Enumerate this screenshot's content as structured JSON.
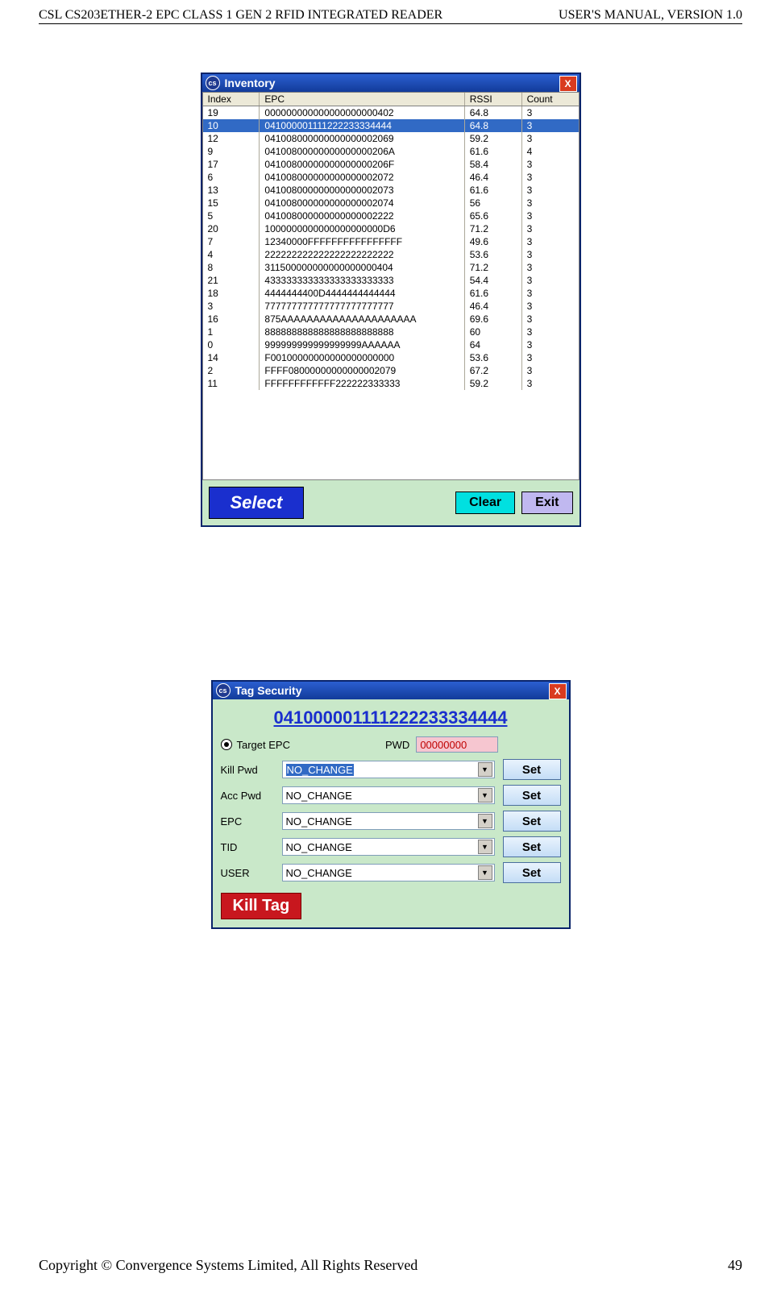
{
  "header": {
    "left": "CSL CS203ETHER-2 EPC CLASS 1 GEN 2 RFID INTEGRATED READER",
    "right": "USER'S  MANUAL,  VERSION  1.0"
  },
  "footer": {
    "left": "Copyright © Convergence Systems Limited, All Rights Reserved",
    "right": "49"
  },
  "inventory": {
    "title": "Inventory",
    "close": "X",
    "columns": {
      "index": "Index",
      "epc": "EPC",
      "rssi": "RSSI",
      "count": "Count"
    },
    "rows": [
      {
        "idx": "19",
        "epc": "000000000000000000000402",
        "rssi": "64.8",
        "cnt": "3",
        "sel": false
      },
      {
        "idx": "10",
        "epc": "041000001111222233334444",
        "rssi": "64.8",
        "cnt": "3",
        "sel": true
      },
      {
        "idx": "12",
        "epc": "041008000000000000002069",
        "rssi": "59.2",
        "cnt": "3",
        "sel": false
      },
      {
        "idx": "9",
        "epc": "04100800000000000000206A",
        "rssi": "61.6",
        "cnt": "4",
        "sel": false
      },
      {
        "idx": "17",
        "epc": "04100800000000000000206F",
        "rssi": "58.4",
        "cnt": "3",
        "sel": false
      },
      {
        "idx": "6",
        "epc": "041008000000000000002072",
        "rssi": "46.4",
        "cnt": "3",
        "sel": false
      },
      {
        "idx": "13",
        "epc": "041008000000000000002073",
        "rssi": "61.6",
        "cnt": "3",
        "sel": false
      },
      {
        "idx": "15",
        "epc": "041008000000000000002074",
        "rssi": "56",
        "cnt": "3",
        "sel": false
      },
      {
        "idx": "5",
        "epc": "041008000000000000002222",
        "rssi": "65.6",
        "cnt": "3",
        "sel": false
      },
      {
        "idx": "20",
        "epc": "1000000000000000000000D6",
        "rssi": "71.2",
        "cnt": "3",
        "sel": false
      },
      {
        "idx": "7",
        "epc": "12340000FFFFFFFFFFFFFFFF",
        "rssi": "49.6",
        "cnt": "3",
        "sel": false
      },
      {
        "idx": "4",
        "epc": "222222222222222222222222",
        "rssi": "53.6",
        "cnt": "3",
        "sel": false
      },
      {
        "idx": "8",
        "epc": "311500000000000000000404",
        "rssi": "71.2",
        "cnt": "3",
        "sel": false
      },
      {
        "idx": "21",
        "epc": "433333333333333333333333",
        "rssi": "54.4",
        "cnt": "3",
        "sel": false
      },
      {
        "idx": "18",
        "epc": "4444444400D4444444444444",
        "rssi": "61.6",
        "cnt": "3",
        "sel": false
      },
      {
        "idx": "3",
        "epc": "777777777777777777777777",
        "rssi": "46.4",
        "cnt": "3",
        "sel": false
      },
      {
        "idx": "16",
        "epc": "875AAAAAAAAAAAAAAAAAAAAA",
        "rssi": "69.6",
        "cnt": "3",
        "sel": false
      },
      {
        "idx": "1",
        "epc": "888888888888888888888888",
        "rssi": "60",
        "cnt": "3",
        "sel": false
      },
      {
        "idx": "0",
        "epc": "999999999999999999AAAAAA",
        "rssi": "64",
        "cnt": "3",
        "sel": false
      },
      {
        "idx": "14",
        "epc": "F00100000000000000000000",
        "rssi": "53.6",
        "cnt": "3",
        "sel": false
      },
      {
        "idx": "2",
        "epc": "FFFF08000000000000002079",
        "rssi": "67.2",
        "cnt": "3",
        "sel": false
      },
      {
        "idx": "11",
        "epc": "FFFFFFFFFFFF222222333333",
        "rssi": "59.2",
        "cnt": "3",
        "sel": false
      }
    ],
    "buttons": {
      "select": "Select",
      "clear": "Clear",
      "exit": "Exit"
    }
  },
  "tagSecurity": {
    "title": "Tag Security",
    "close": "X",
    "epc": "041000001111222233334444",
    "targetLabel": "Target EPC",
    "pwdLabel": "PWD",
    "pwdValue": "00000000",
    "setLabel": "Set",
    "fields": [
      {
        "label": "Kill Pwd",
        "value": "NO_CHANGE",
        "hl": true
      },
      {
        "label": "Acc Pwd",
        "value": "NO_CHANGE",
        "hl": false
      },
      {
        "label": "EPC",
        "value": "NO_CHANGE",
        "hl": false
      },
      {
        "label": "TID",
        "value": "NO_CHANGE",
        "hl": false
      },
      {
        "label": "USER",
        "value": "NO_CHANGE",
        "hl": false
      }
    ],
    "killTag": "Kill Tag"
  }
}
